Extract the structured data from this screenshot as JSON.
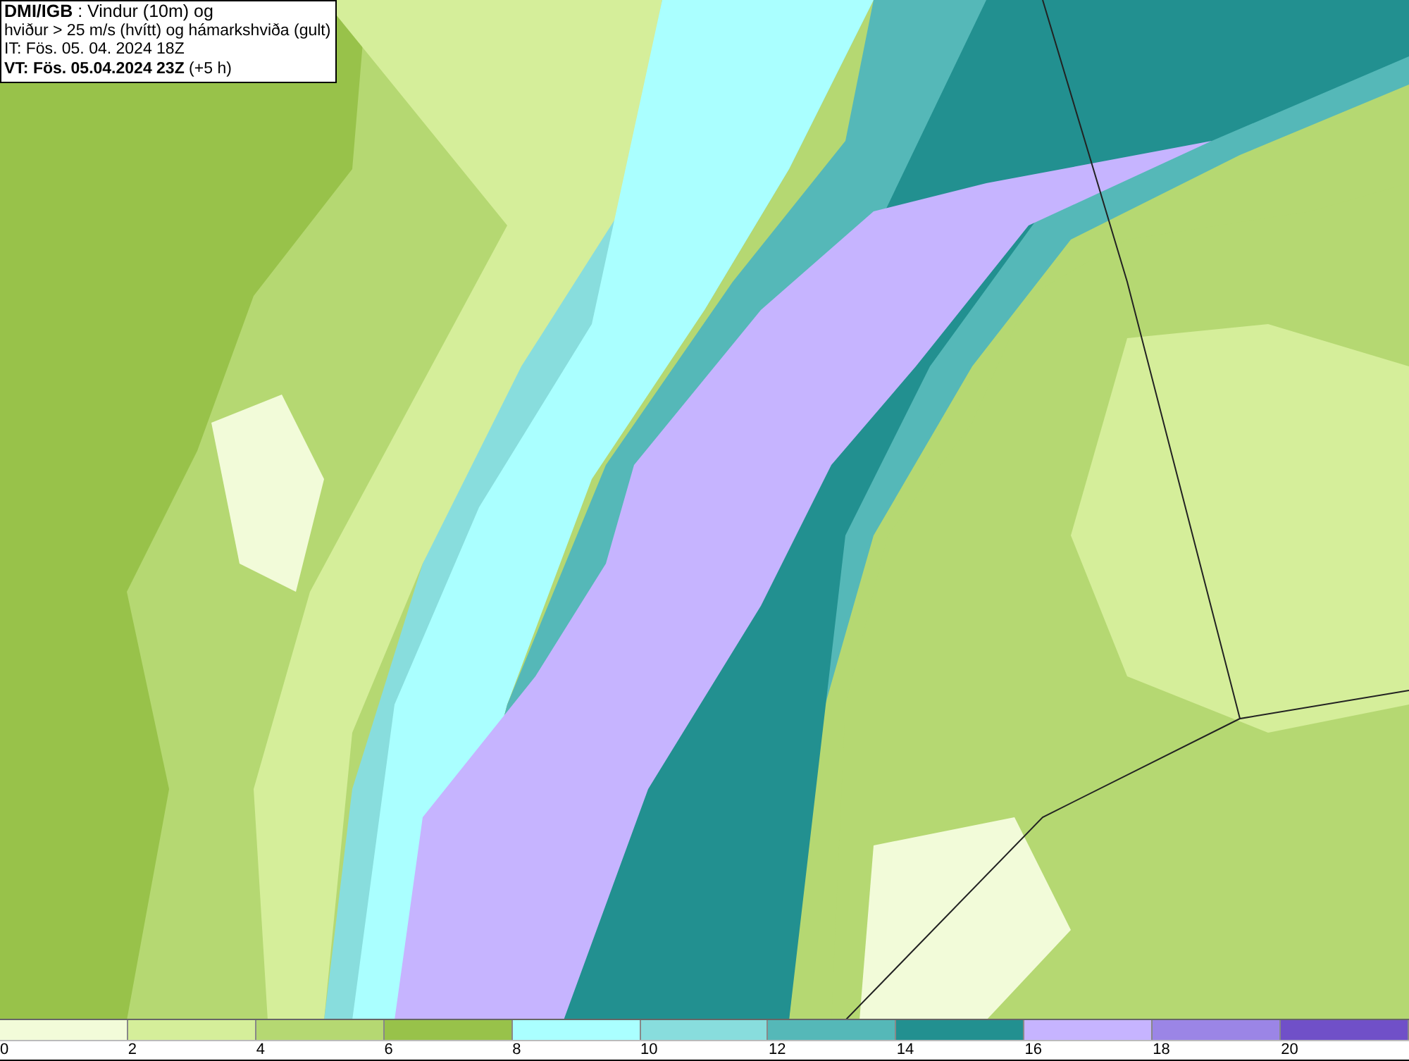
{
  "title_box": {
    "lines": [
      "**DMI/IGB** : Vindur (10m) og",
      "hviður > 25 m/s (hvítt) og hámarkshviða (gult)",
      "IT: Fös. 05. 04. 2024 18Z",
      "**VT: Fös. 05.04.2024 23Z** (+5 h)"
    ]
  },
  "legend": {
    "bins": [
      {
        "label": "0",
        "color": "#f2fbd9"
      },
      {
        "label": "2",
        "color": "#d5ee9a"
      },
      {
        "label": "4",
        "color": "#b5d872"
      },
      {
        "label": "6",
        "color": "#98c24a"
      },
      {
        "label": "8",
        "color": "#aaffff"
      },
      {
        "label": "10",
        "color": "#88dddd"
      },
      {
        "label": "12",
        "color": "#55b8b8"
      },
      {
        "label": "14",
        "color": "#229090"
      },
      {
        "label": "16",
        "color": "#c6b4ff"
      },
      {
        "label": "18",
        "color": "#9b85e6"
      },
      {
        "label": "20",
        "color": "#7050c8"
      }
    ]
  }
}
